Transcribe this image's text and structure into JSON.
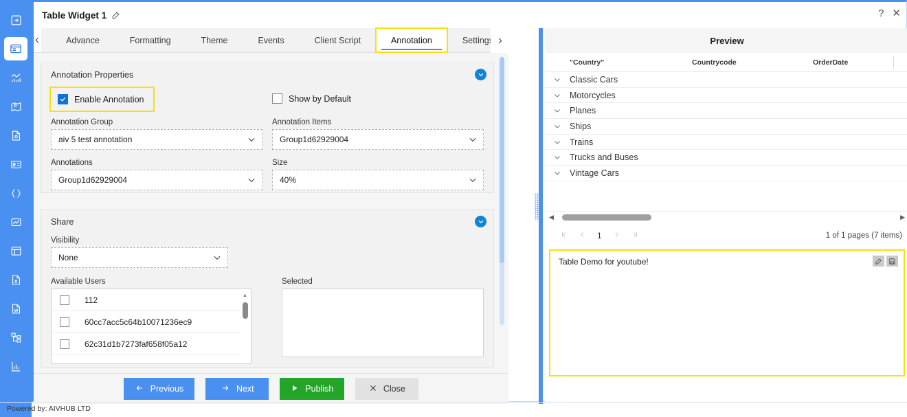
{
  "rail": {
    "items": [
      {
        "icon": "login-arrow-icon",
        "name": "rail-item-login",
        "active": false
      },
      {
        "icon": "dashboard-icon",
        "name": "rail-item-dashboard",
        "active": true
      },
      {
        "icon": "analytics-chart-icon",
        "name": "rail-item-analytics",
        "active": false
      },
      {
        "icon": "map-icon",
        "name": "rail-item-map",
        "active": false
      },
      {
        "icon": "document-icon",
        "name": "rail-item-document",
        "active": false
      },
      {
        "icon": "id-card-icon",
        "name": "rail-item-card",
        "active": false
      },
      {
        "icon": "code-braces-icon",
        "name": "rail-item-code",
        "active": false
      },
      {
        "icon": "image-chart-icon",
        "name": "rail-item-image-chart",
        "active": false
      },
      {
        "icon": "table-icon",
        "name": "rail-item-table",
        "active": false
      },
      {
        "icon": "excel-file-icon",
        "name": "rail-item-excel",
        "active": false
      },
      {
        "icon": "word-file-icon",
        "name": "rail-item-word",
        "active": false
      },
      {
        "icon": "hierarchy-icon",
        "name": "rail-item-hierarchy",
        "active": false
      },
      {
        "icon": "bar-chart-icon",
        "name": "rail-item-bar-chart",
        "active": false
      }
    ]
  },
  "dialog": {
    "title": "Table Widget 1",
    "edit_icon": "edit-pencil-icon",
    "help_label": "?",
    "close_label": "✕"
  },
  "tabs": {
    "prev_label": "‹",
    "next_label": "›",
    "items": [
      {
        "label": "Advance",
        "selected": false
      },
      {
        "label": "Formatting",
        "selected": false
      },
      {
        "label": "Theme",
        "selected": false
      },
      {
        "label": "Events",
        "selected": false
      },
      {
        "label": "Client Script",
        "selected": false
      },
      {
        "label": "Annotation",
        "selected": true
      },
      {
        "label": "Settings",
        "selected": false
      }
    ]
  },
  "annotation_properties": {
    "header": "Annotation Properties",
    "enable_annotation_label": "Enable Annotation",
    "enable_annotation_checked": true,
    "show_by_default_label": "Show by Default",
    "show_by_default_checked": false,
    "fields": {
      "annotation_group_label": "Annotation Group",
      "annotation_group_value": "aiv 5 test annotation",
      "annotation_items_label": "Annotation Items",
      "annotation_items_value": "Group1d62929004",
      "annotations_label": "Annotations",
      "annotations_value": "Group1d62929004",
      "size_label": "Size",
      "size_value": "40%"
    }
  },
  "share": {
    "header": "Share",
    "visibility_label": "Visibility",
    "visibility_value": "None",
    "available_users_label": "Available Users",
    "available_users": [
      {
        "label": "112",
        "checked": false
      },
      {
        "label": "60cc7acc5c64b10071236ec9",
        "checked": false
      },
      {
        "label": "62c31d1b7273faf658f05a12",
        "checked": false
      }
    ],
    "selected_label": "Selected",
    "selected_items": []
  },
  "footer": {
    "previous_label": "Previous",
    "previous_icon": "arrow-left-icon",
    "next_label": "Next",
    "next_icon": "arrow-right-icon",
    "publish_label": "Publish",
    "publish_icon": "play-triangle-icon",
    "close_label": "Close",
    "close_icon": "x-icon"
  },
  "preview": {
    "title": "Preview",
    "columns": [
      "\"Country\"",
      "Countrycode",
      "OrderDate"
    ],
    "rows": [
      {
        "country": "Classic Cars"
      },
      {
        "country": "Motorcycles"
      },
      {
        "country": "Planes"
      },
      {
        "country": "Ships"
      },
      {
        "country": "Trains"
      },
      {
        "country": "Trucks and Buses"
      },
      {
        "country": "Vintage Cars"
      }
    ],
    "pager": {
      "first_label": "⟨⟨",
      "prev_label": "‹",
      "current_page": "1",
      "next_label": "›",
      "last_label": "⟩⟩",
      "info": "1 of 1 pages (7 items)"
    },
    "annotation_note": {
      "text": "Table Demo for youtube!",
      "edit_icon": "edit-pencil-icon",
      "save_icon": "save-floppy-icon"
    }
  },
  "status": {
    "powered_by": "Powered by: AIVHUB LTD"
  },
  "colors": {
    "accent_blue": "#4a90f0",
    "publish_green": "#23a52a",
    "highlight_yellow": "#f5e010",
    "collapse_blue": "#1284d8"
  }
}
